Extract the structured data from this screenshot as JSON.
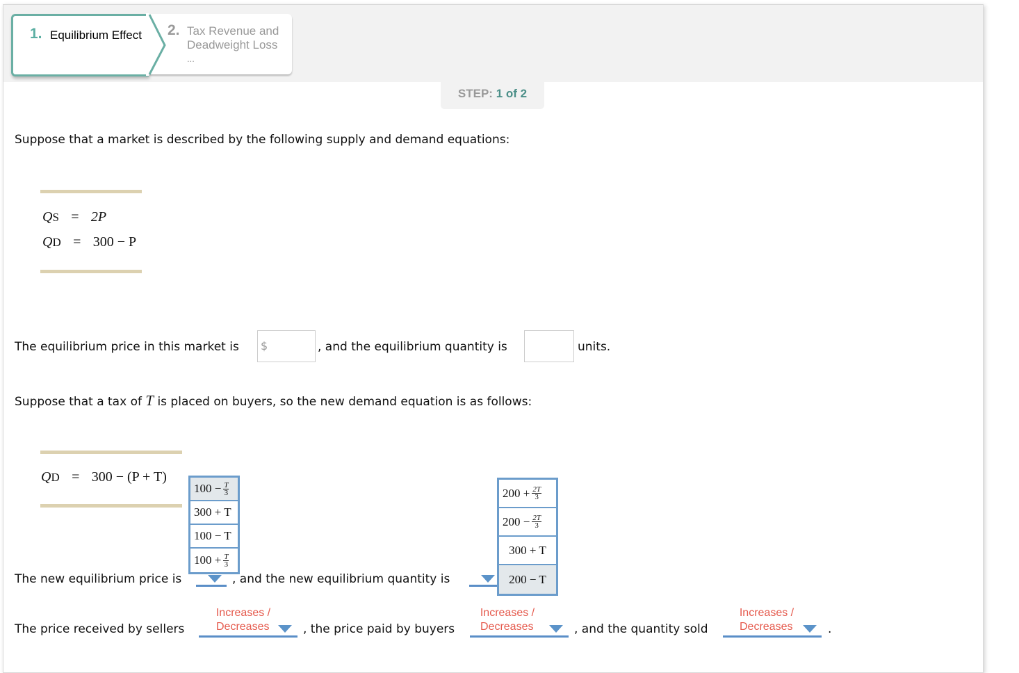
{
  "tabs": [
    {
      "number": "1.",
      "label": "Equilibrium Effect",
      "active": true
    },
    {
      "number": "2.",
      "label_line1": "Tax Revenue and",
      "label_line2": "Deadweight Loss",
      "more": "...",
      "active": false
    }
  ],
  "step": {
    "label": "STEP:",
    "value": "1 of 2"
  },
  "intro": "Suppose that a market is described by the following supply and demand equations:",
  "equations": {
    "supply": {
      "lhs": "Q",
      "sub": "S",
      "eq": "=",
      "rhs": "2P"
    },
    "demand": {
      "lhs": "Q",
      "sub": "D",
      "eq": "=",
      "rhs": "300 − P"
    }
  },
  "q1": {
    "part1": "The equilibrium price in this market is",
    "currency": "$",
    "price_value": "",
    "part2": ", and the equilibrium quantity is",
    "quantity_value": "",
    "part3": "units."
  },
  "tax_intro": {
    "before": "Suppose that a tax of",
    "var": "T",
    "after": "is placed on buyers, so the new demand equation is as follows:"
  },
  "new_demand": {
    "lhs": "Q",
    "sub": "D",
    "eq": "=",
    "rhs": "300 − (P + T)"
  },
  "price_menu": {
    "options": [
      {
        "base": "100 −",
        "num": "T",
        "den": "3",
        "selected": true
      },
      {
        "text": "300 + T"
      },
      {
        "text": "100 − T"
      },
      {
        "base": "100 +",
        "num": "T",
        "den": "3"
      }
    ]
  },
  "quantity_menu": {
    "options": [
      {
        "base": "200 +",
        "num": "2T",
        "den": "3"
      },
      {
        "base": "200 −",
        "num": "2T",
        "den": "3"
      },
      {
        "text": "300 + T"
      },
      {
        "text": "200 − T",
        "selected": true
      }
    ]
  },
  "q2": {
    "part1": "The new equilibrium price is",
    "part2": ", and the new equilibrium quantity is"
  },
  "q3": {
    "part1": "The price received by sellers",
    "part2": ", the price paid by buyers",
    "part3": ", and the quantity sold",
    "end": ".",
    "dropdown_line1": "Increases /",
    "dropdown_line2": "Decreases"
  },
  "colors": {
    "accent": "#5aaea2",
    "dropdown": "#5b93c9",
    "placeholder_red": "#e55a4d",
    "rule": "#dcd1b0"
  }
}
